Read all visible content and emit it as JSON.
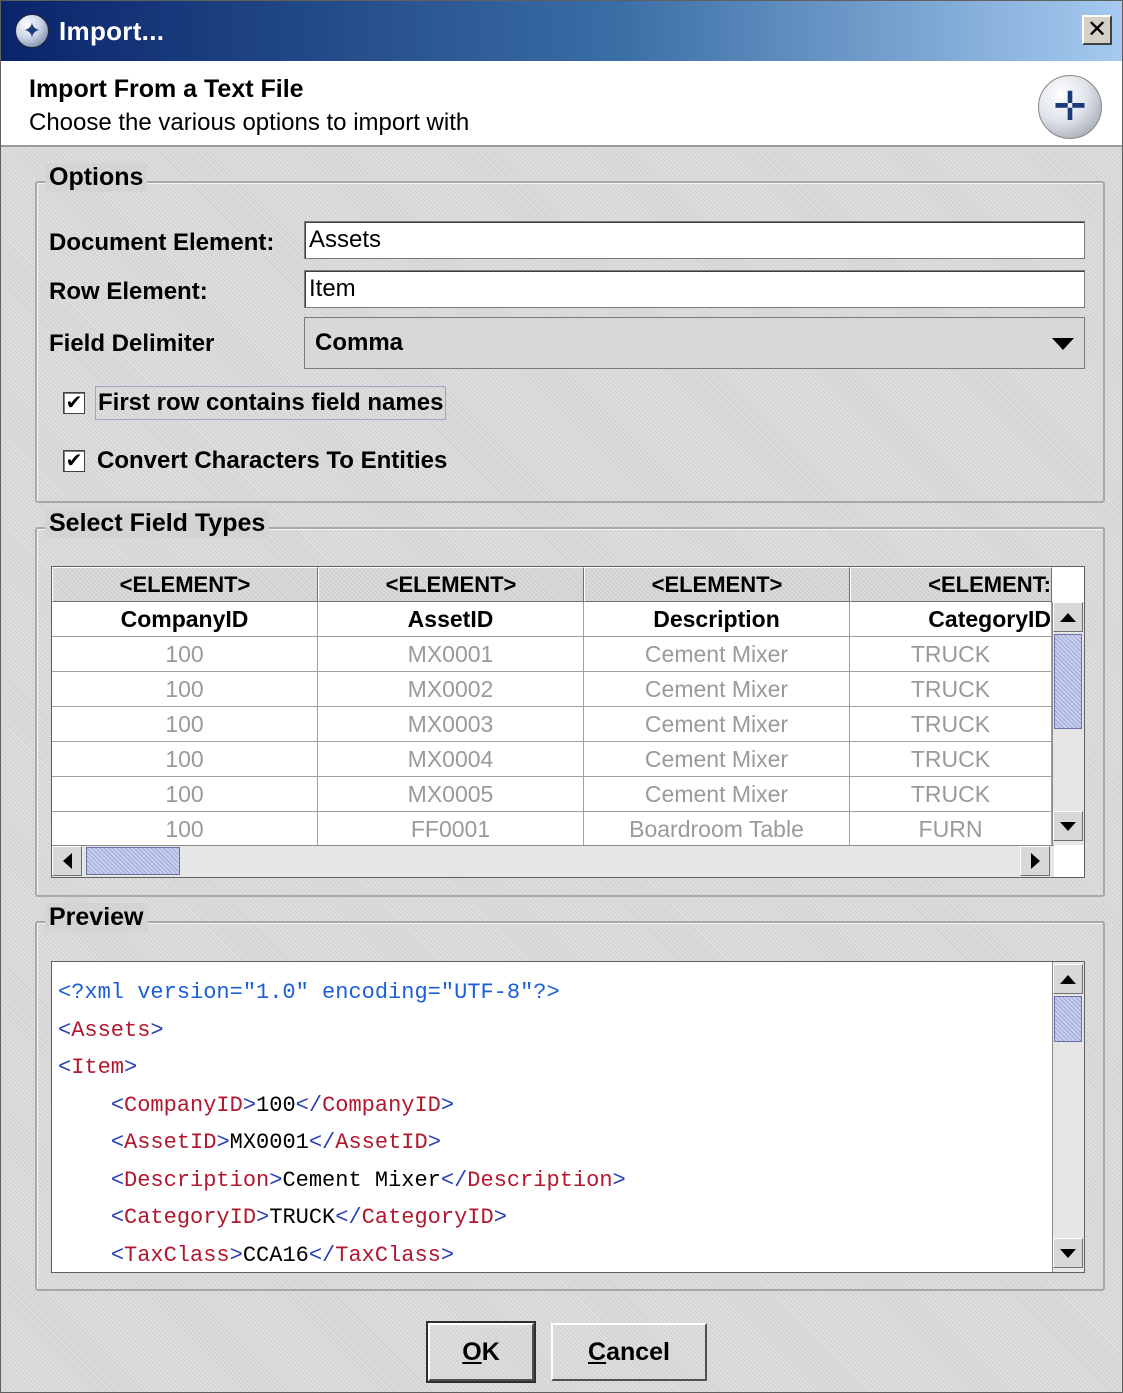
{
  "window": {
    "title": "Import...",
    "close_glyph": "✕"
  },
  "banner": {
    "title": "Import From a Text File",
    "subtitle": "Choose the various options to import with"
  },
  "options": {
    "legend": "Options",
    "document_element_label": "Document Element:",
    "document_element_value": "Assets",
    "row_element_label": "Row Element:",
    "row_element_value": "Item",
    "field_delimiter_label": "Field Delimiter",
    "field_delimiter_value": "Comma",
    "first_row_label": "First row contains field names",
    "first_row_checked": true,
    "convert_label": "Convert Characters To Entities",
    "convert_checked": true
  },
  "field_types": {
    "legend": "Select Field Types",
    "types": [
      "<ELEMENT>",
      "<ELEMENT>",
      "<ELEMENT>",
      "<ELEMENT:"
    ],
    "columns": [
      "CompanyID",
      "AssetID",
      "Description",
      "CategoryID"
    ],
    "rows": [
      [
        "100",
        "MX0001",
        "Cement Mixer",
        "TRUCK"
      ],
      [
        "100",
        "MX0002",
        "Cement Mixer",
        "TRUCK"
      ],
      [
        "100",
        "MX0003",
        "Cement Mixer",
        "TRUCK"
      ],
      [
        "100",
        "MX0004",
        "Cement Mixer",
        "TRUCK"
      ],
      [
        "100",
        "MX0005",
        "Cement Mixer",
        "TRUCK"
      ],
      [
        "100",
        "FF0001",
        "Boardroom Table",
        "FURN"
      ]
    ]
  },
  "preview": {
    "legend": "Preview",
    "lines": [
      {
        "indent": "",
        "parts": [
          [
            "decl",
            "<?xml version=\"1.0\" encoding=\"UTF-8\"?>"
          ]
        ]
      },
      {
        "indent": "",
        "parts": [
          [
            "br",
            "<"
          ],
          [
            "tag",
            "Assets"
          ],
          [
            "br",
            ">"
          ]
        ]
      },
      {
        "indent": "",
        "parts": [
          [
            "br",
            "<"
          ],
          [
            "tag",
            "Item"
          ],
          [
            "br",
            ">"
          ]
        ]
      },
      {
        "indent": "    ",
        "parts": [
          [
            "br",
            "<"
          ],
          [
            "tag",
            "CompanyID"
          ],
          [
            "br",
            ">"
          ],
          [
            "txt",
            "100"
          ],
          [
            "br",
            "</"
          ],
          [
            "tag",
            "CompanyID"
          ],
          [
            "br",
            ">"
          ]
        ]
      },
      {
        "indent": "    ",
        "parts": [
          [
            "br",
            "<"
          ],
          [
            "tag",
            "AssetID"
          ],
          [
            "br",
            ">"
          ],
          [
            "txt",
            "MX0001"
          ],
          [
            "br",
            "</"
          ],
          [
            "tag",
            "AssetID"
          ],
          [
            "br",
            ">"
          ]
        ]
      },
      {
        "indent": "    ",
        "parts": [
          [
            "br",
            "<"
          ],
          [
            "tag",
            "Description"
          ],
          [
            "br",
            ">"
          ],
          [
            "txt",
            "Cement Mixer"
          ],
          [
            "br",
            "</"
          ],
          [
            "tag",
            "Description"
          ],
          [
            "br",
            ">"
          ]
        ]
      },
      {
        "indent": "    ",
        "parts": [
          [
            "br",
            "<"
          ],
          [
            "tag",
            "CategoryID"
          ],
          [
            "br",
            ">"
          ],
          [
            "txt",
            "TRUCK"
          ],
          [
            "br",
            "</"
          ],
          [
            "tag",
            "CategoryID"
          ],
          [
            "br",
            ">"
          ]
        ]
      },
      {
        "indent": "    ",
        "parts": [
          [
            "br",
            "<"
          ],
          [
            "tag",
            "TaxClass"
          ],
          [
            "br",
            ">"
          ],
          [
            "txt",
            "CCA16"
          ],
          [
            "br",
            "</"
          ],
          [
            "tag",
            "TaxClass"
          ],
          [
            "br",
            ">"
          ]
        ]
      }
    ]
  },
  "buttons": {
    "ok_mnemonic": "O",
    "ok_rest": "K",
    "cancel_mnemonic": "C",
    "cancel_rest": "ancel"
  },
  "icons": {
    "app": "app-logo-icon",
    "banner": "import-logo-icon",
    "close": "close-icon",
    "checkmark": "checkmark-icon",
    "dropdown": "chevron-down-icon"
  },
  "colors": {
    "title_gradient_start": "#0a246a",
    "xml_tag": "#b01830",
    "xml_decl": "#1a5fd8",
    "scroll_thumb": "#9fa8d8"
  }
}
